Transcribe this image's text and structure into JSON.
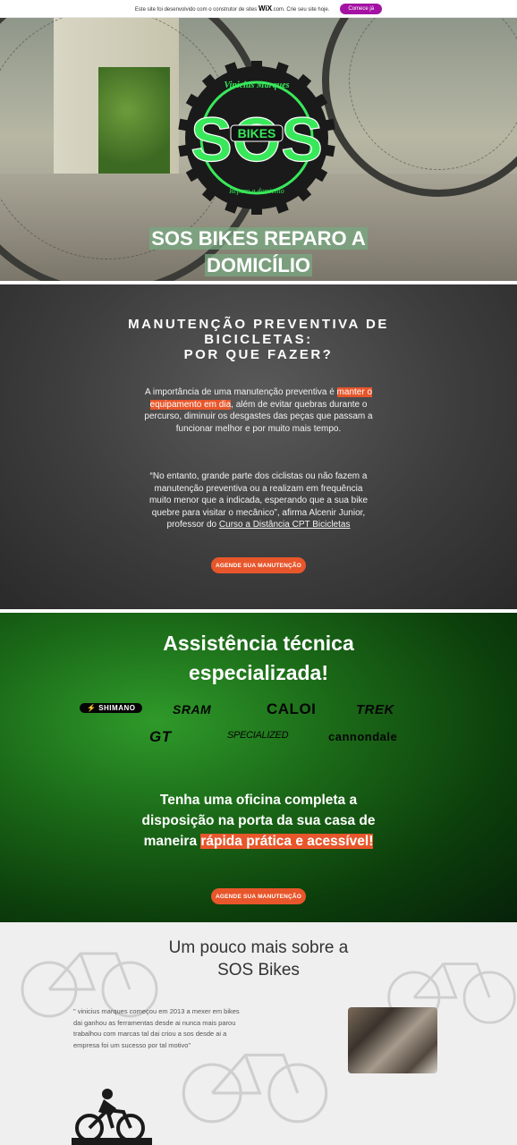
{
  "wix_bar": {
    "text_before": "Este site foi desenvolvido com o construtor de sites",
    "brand": "WiX",
    "text_after": ".com. Crie seu site hoje.",
    "button": "Comece já"
  },
  "hero": {
    "logo": {
      "top_text": "Vinicius Marques",
      "big_text": "SOS",
      "badge_text": "BIKES",
      "bottom_text": "Reparo a domicilio"
    },
    "title_line1": "SOS BIKES REPARO A",
    "title_line2": "DOMICÍLIO"
  },
  "maintenance": {
    "heading_line1": "MANUTENÇÃO PREVENTIVA DE",
    "heading_line2": "BICICLETAS:",
    "heading_line3": "POR QUE FAZER?",
    "para1_before": "A importância de uma manutenção preventiva é",
    "para1_highlight": "manter o equipamento em dia",
    "para1_after": ", além de evitar quebras durante o percurso, diminuir os desgastes das peças que passam a funcionar melhor e por muito mais tempo.",
    "para2_text": "“No entanto, grande parte dos ciclistas ou não fazem a manutenção preventiva ou a realizam em frequência muito menor que a indicada, esperando que a sua bike quebre para visitar o mecânico”, afirma Alcenir Junior, professor do",
    "para2_link": "Curso a Distância CPT Bicicletas",
    "cta": "AGENDE SUA MANUTENÇÃO"
  },
  "assistance": {
    "heading_line1": "Assistência técnica",
    "heading_line2": "especializada!",
    "brands": [
      "SHIMANO",
      "SRAM",
      "CALOI",
      "TREK",
      "GT",
      "SPECIALIZED",
      "cannondale"
    ],
    "tagline_line1": "Tenha uma oficina completa a",
    "tagline_line2": "disposição na porta da sua casa de",
    "tagline_before": "maneira ",
    "tagline_highlight": "rápida prática e acessível!",
    "cta": "AGENDE SUA MANUTENÇÃO"
  },
  "about": {
    "heading_line1": "Um pouco mais sobre a",
    "heading_line2": "SOS Bikes",
    "quote": "\" vinicius marques começou em 2013 a mexer em bikes dai ganhou as ferramentas desde ai nunca mais parou trabalhou com marcas tal dai criou a sos desde ai a empresa foi um sucesso por tal motivo\""
  },
  "colors": {
    "accent": "#e8562b",
    "logo_green": "#39e85a",
    "wix_purple": "#a312a3"
  }
}
